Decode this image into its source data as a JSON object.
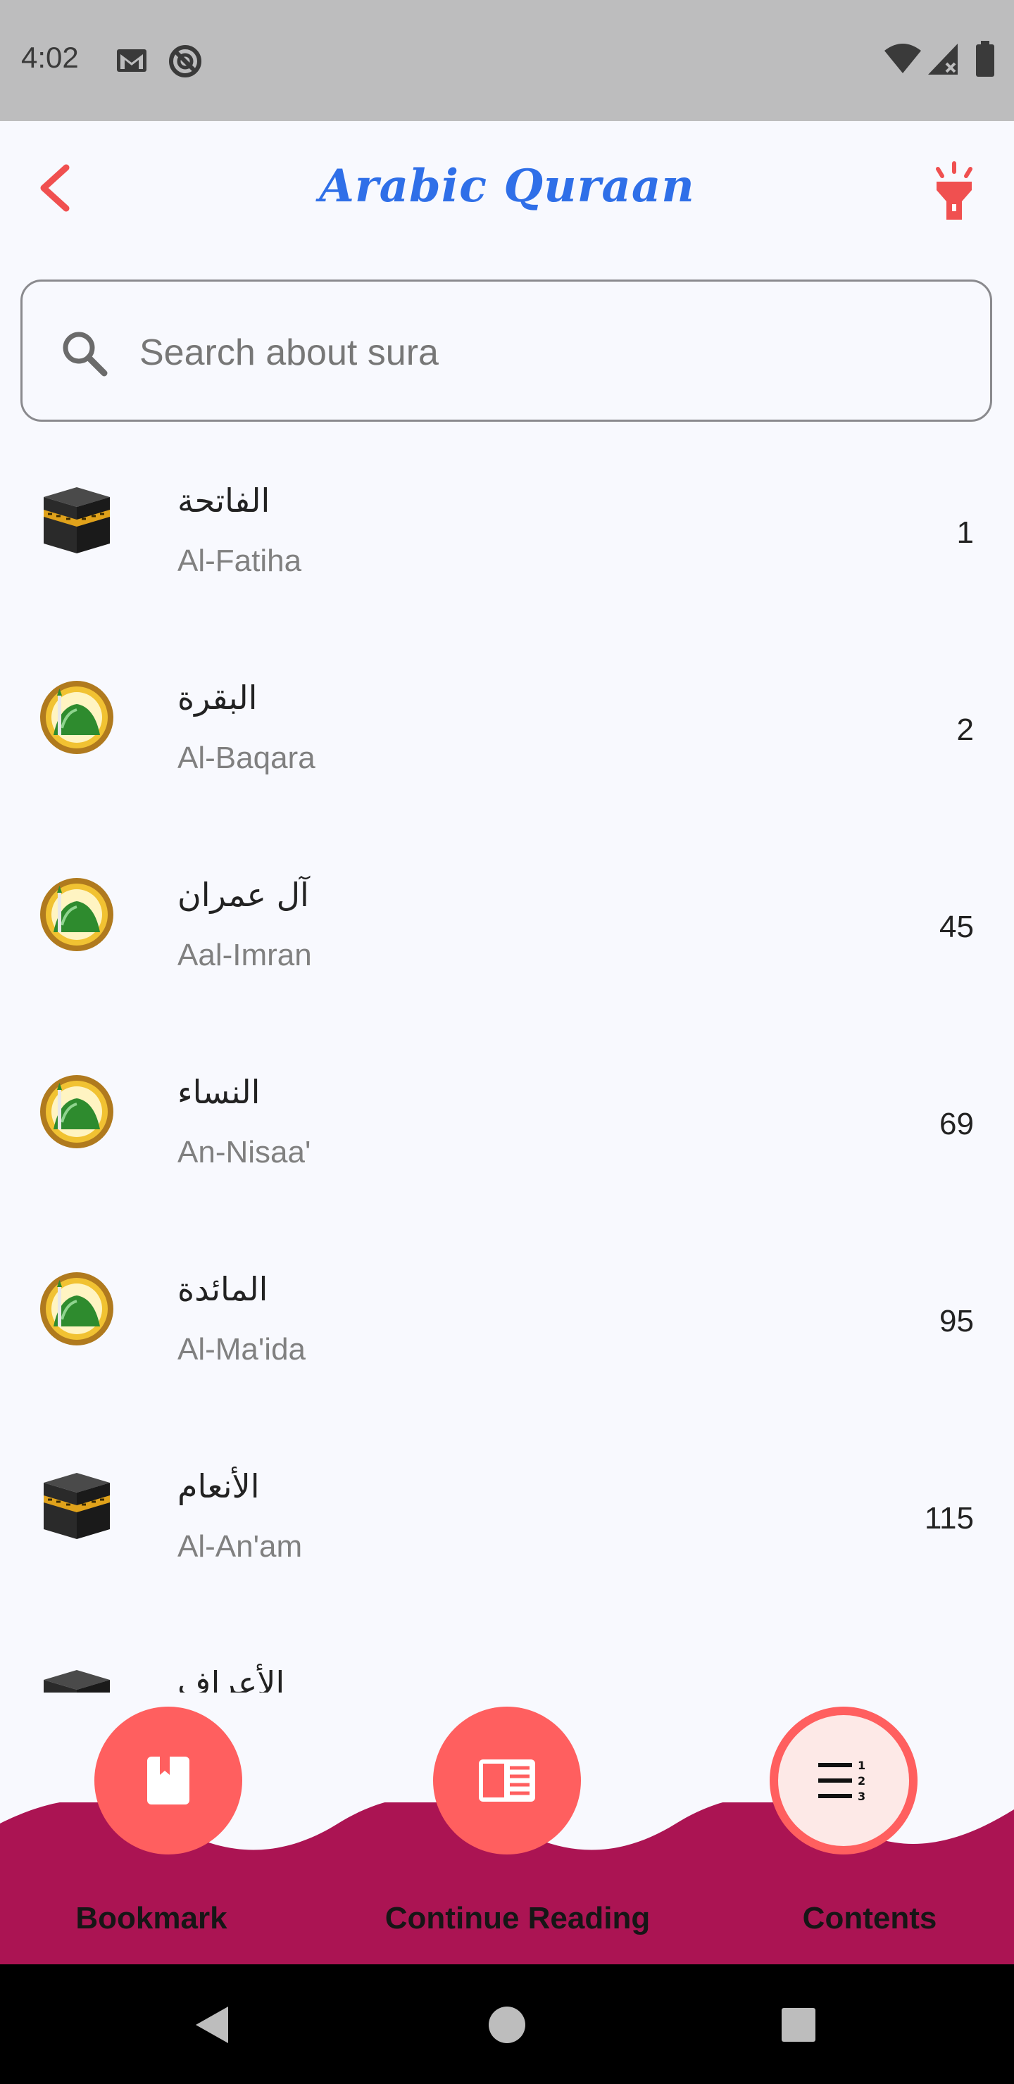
{
  "status_bar": {
    "time": "4:02",
    "left_icons": [
      "gmail-icon",
      "do-not-disturb-icon"
    ],
    "right_icons": [
      "wifi-icon",
      "signal-icon",
      "battery-icon"
    ]
  },
  "app_bar": {
    "title": "Arabic Quraan",
    "title_color": "#2f6fe8",
    "accent_color": "#f05050",
    "left_icon": "back-chevron-icon",
    "right_icon": "flashlight-icon"
  },
  "search": {
    "placeholder": "Search about sura",
    "value": ""
  },
  "suras": [
    {
      "arabic": "الفاتحة",
      "latin": "Al-Fatiha",
      "page": "1",
      "icon": "kaaba-icon"
    },
    {
      "arabic": "البقرة",
      "latin": "Al-Baqara",
      "page": "2",
      "icon": "mosque-dome-icon"
    },
    {
      "arabic": "آل عمران",
      "latin": "Aal-Imran",
      "page": "45",
      "icon": "mosque-dome-icon"
    },
    {
      "arabic": "النساء",
      "latin": "An-Nisaa'",
      "page": "69",
      "icon": "mosque-dome-icon"
    },
    {
      "arabic": "المائدة",
      "latin": "Al-Ma'ida",
      "page": "95",
      "icon": "mosque-dome-icon"
    },
    {
      "arabic": "الأنعام",
      "latin": "Al-An'am",
      "page": "115",
      "icon": "kaaba-icon"
    },
    {
      "arabic": "الأعراف",
      "latin": "",
      "page": "",
      "icon": "kaaba-icon"
    }
  ],
  "bottom_nav": {
    "bookmark_label": "Bookmark",
    "continue_label": "Continue Reading",
    "contents_label": "Contents",
    "selected": "Contents",
    "bar_color": "#ab1453",
    "button_color": "#ff5f5f"
  },
  "system_nav": {
    "icons": [
      "back-triangle-icon",
      "home-circle-icon",
      "recents-square-icon"
    ]
  }
}
